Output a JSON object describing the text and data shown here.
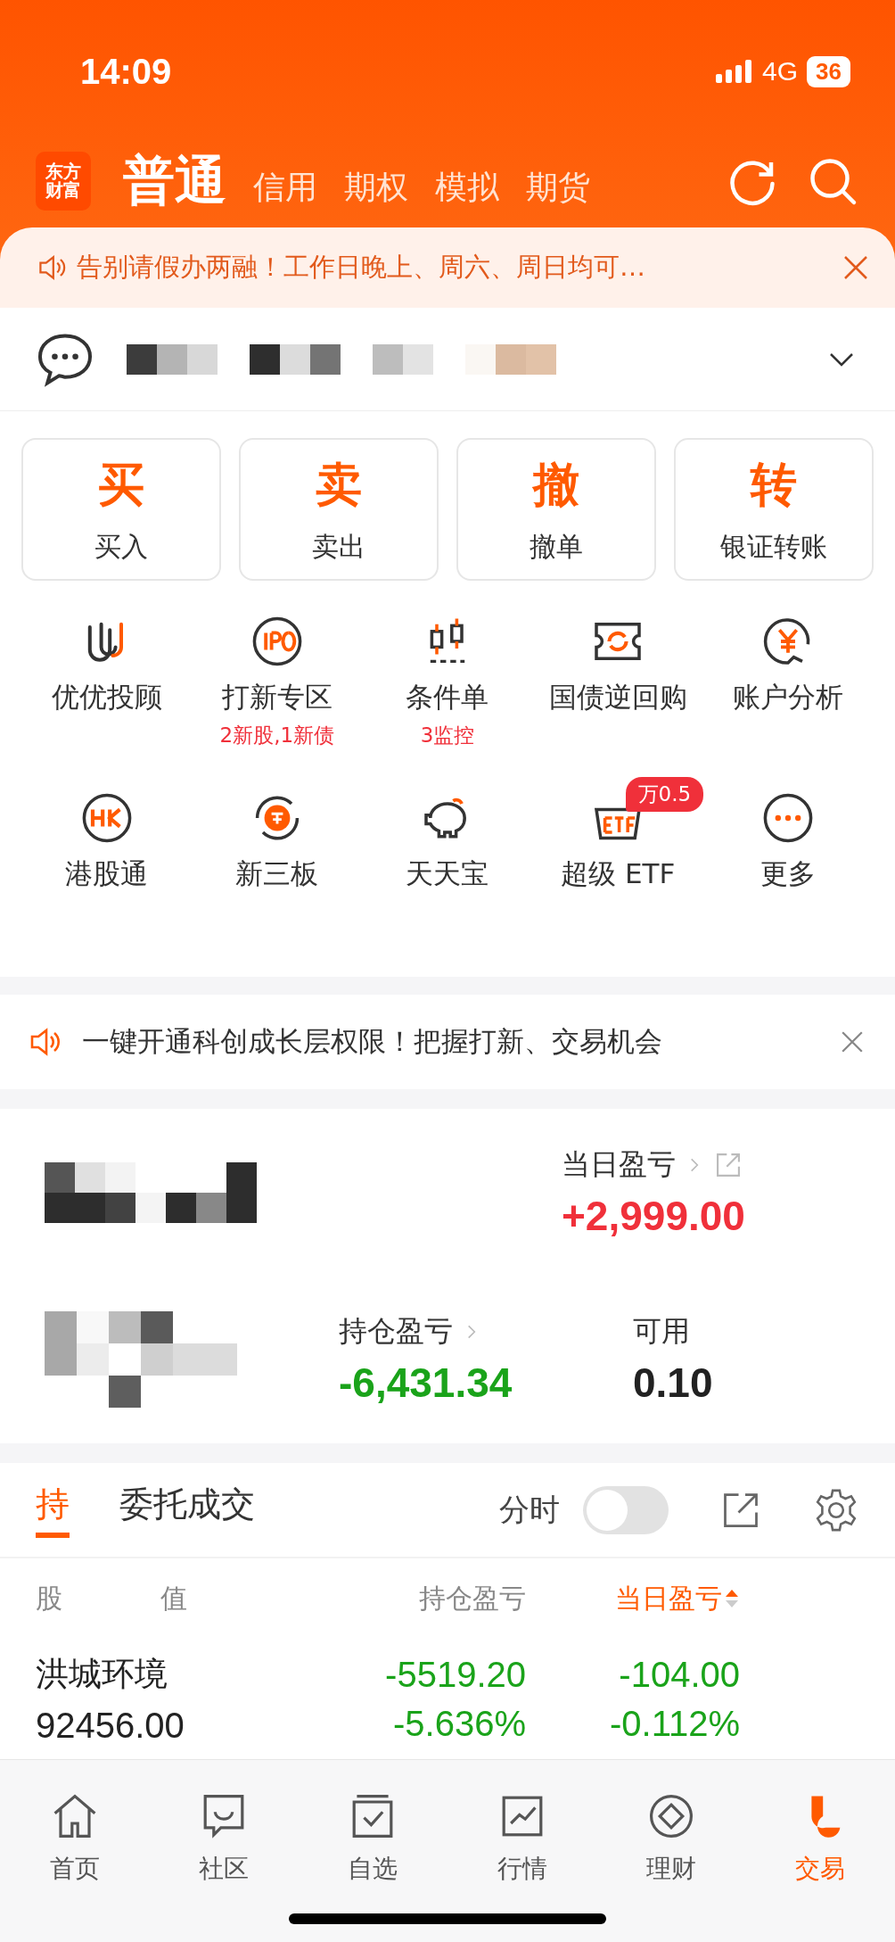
{
  "status_bar": {
    "time": "14:09",
    "network": "4G",
    "battery": "36"
  },
  "header": {
    "logo_lines": [
      "东方",
      "财富"
    ],
    "tabs": [
      {
        "label": "普通",
        "selected": true
      },
      {
        "label": "信用",
        "selected": false
      },
      {
        "label": "期权",
        "selected": false
      },
      {
        "label": "模拟",
        "selected": false
      },
      {
        "label": "期货",
        "selected": false
      }
    ]
  },
  "banner": {
    "text": "告别请假办两融！工作日晚上、周六、周日均可…"
  },
  "trade_buttons": [
    {
      "glyph": "买",
      "label": "买入"
    },
    {
      "glyph": "卖",
      "label": "卖出"
    },
    {
      "glyph": "撤",
      "label": "撤单"
    },
    {
      "glyph": "转",
      "label": "银证转账"
    }
  ],
  "services": [
    {
      "label": "优优投顾"
    },
    {
      "label": "打新专区",
      "sub": "2新股,1新债"
    },
    {
      "label": "条件单",
      "sub": "3监控"
    },
    {
      "label": "国债逆回购"
    },
    {
      "label": "账户分析"
    },
    {
      "label": "港股通"
    },
    {
      "label": "新三板"
    },
    {
      "label": "天天宝"
    },
    {
      "label": "超级 ETF",
      "badge": "万0.5"
    },
    {
      "label": "更多"
    }
  ],
  "notice": {
    "text": "一键开通科创成长层权限！把握打新、交易机会"
  },
  "account": {
    "daily_label": "当日盈亏",
    "daily_value": "+2,999.00",
    "holding_label": "持仓盈亏",
    "holding_value": "-6,431.34",
    "available_label": "可用",
    "available_value": "0.10"
  },
  "positions": {
    "tabs": [
      {
        "label": "持",
        "selected": true
      },
      {
        "label": "委托成交",
        "selected": false
      }
    ],
    "time_share": {
      "label": "分时",
      "on": false
    },
    "columns": [
      {
        "label": "股",
        "sorted": false
      },
      {
        "label": "值",
        "sorted": false
      },
      {
        "label": "持仓盈亏",
        "sorted": false
      },
      {
        "label": "当日盈亏",
        "sorted": true
      }
    ],
    "rows": [
      {
        "name": "洪城环境",
        "value": "92456.00",
        "holding_pnl": "-5519.20",
        "holding_pct": "-5.636%",
        "daily_pnl": "-104.00",
        "daily_pct": "-0.112%"
      }
    ]
  },
  "nav": [
    {
      "label": "首页",
      "selected": false
    },
    {
      "label": "社区",
      "selected": false
    },
    {
      "label": "自选",
      "selected": false
    },
    {
      "label": "行情",
      "selected": false
    },
    {
      "label": "理财",
      "selected": false
    },
    {
      "label": "交易",
      "selected": true
    }
  ]
}
